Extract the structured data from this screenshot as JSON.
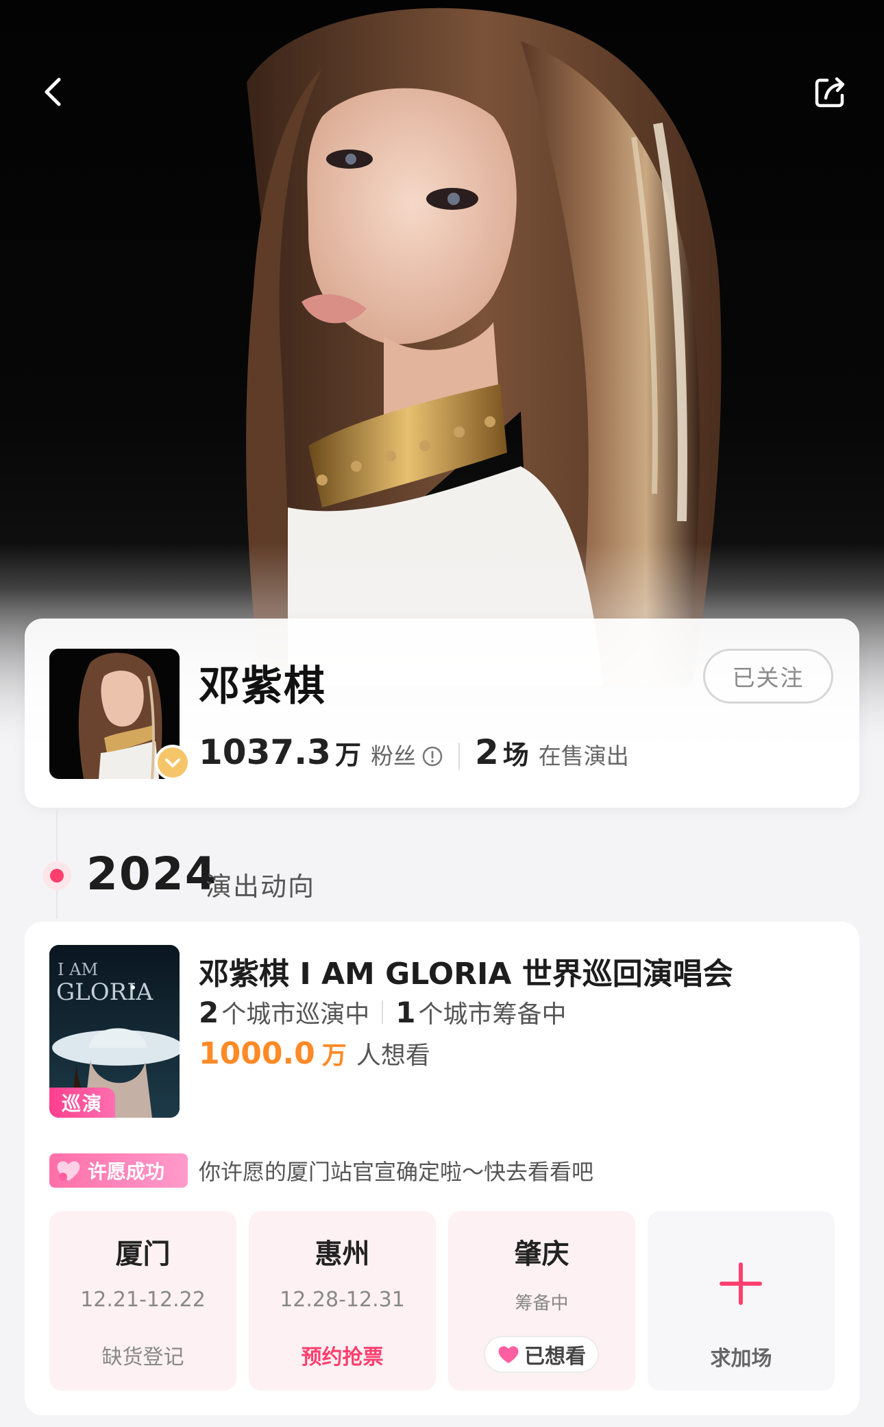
{
  "nav": {
    "back_icon": "chevron-left-icon",
    "share_icon": "share-icon"
  },
  "artist": {
    "name": "邓紫棋",
    "follow_label": "已关注",
    "fans_count": "1037.3",
    "fans_unit": "万",
    "fans_label": "粉丝",
    "shows_count": "2",
    "shows_unit": "场",
    "shows_label": "在售演出"
  },
  "timeline": {
    "year": "2024",
    "label": "演出动向"
  },
  "tour": {
    "tag": "巡演",
    "title": "邓紫棋 I AM GLORIA 世界巡回演唱会",
    "touring_count": "2",
    "touring_label": "个城市巡演中",
    "planning_count": "1",
    "planning_label": "个城市筹备中",
    "want_count": "1000.0",
    "want_unit": "万",
    "want_label": "人想看",
    "wish_badge": "许愿成功",
    "wish_text": "你许愿的厦门站官宣确定啦～快去看看吧",
    "cities": [
      {
        "name": "厦门",
        "date": "12.21-12.22",
        "action": "缺货登记"
      },
      {
        "name": "惠州",
        "date": "12.28-12.31",
        "action": "预约抢票"
      },
      {
        "name": "肇庆",
        "date": "筹备中",
        "action": "已想看"
      }
    ],
    "add_label": "求加场"
  },
  "colors": {
    "accent_pink": "#ff3f6e",
    "want_orange": "#ff8a26",
    "verified_gold": "#f6c569"
  }
}
